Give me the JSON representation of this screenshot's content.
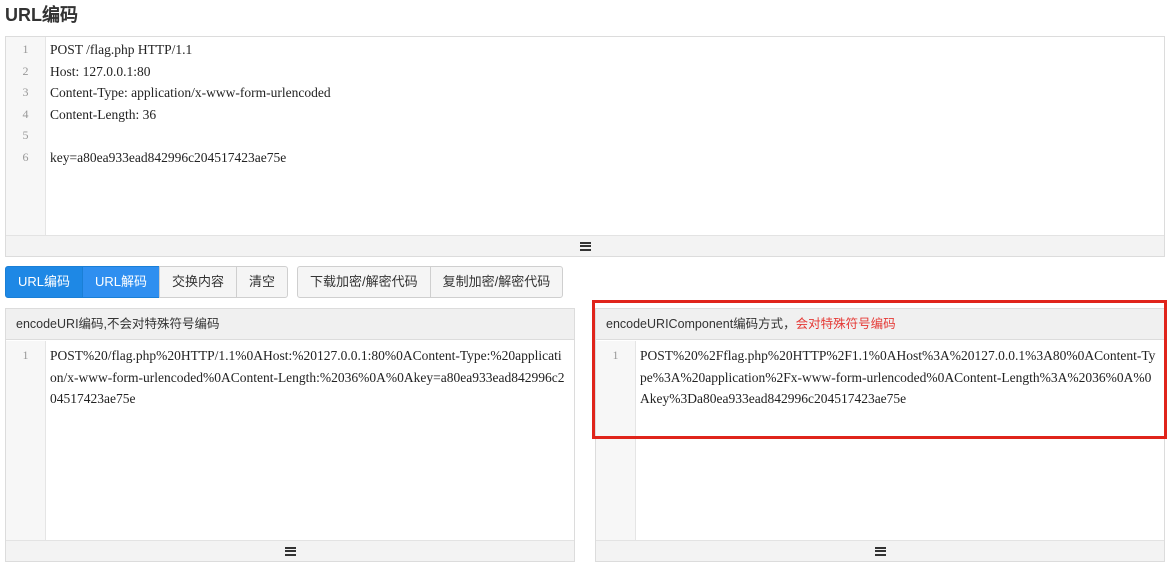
{
  "page": {
    "title": "URL编码"
  },
  "input_editor": {
    "line_numbers": [
      "1",
      "2",
      "3",
      "4",
      "5",
      "6"
    ],
    "lines": [
      "POST /flag.php HTTP/1.1",
      "Host: 127.0.0.1:80",
      "Content-Type: application/x-www-form-urlencoded",
      "Content-Length: 36",
      "",
      "key=a80ea933ead842996c204517423ae75e"
    ]
  },
  "toolbar": {
    "group1": [
      "URL编码",
      "URL解码",
      "交换内容",
      "清空"
    ],
    "group2": [
      "下载加密/解密代码",
      "复制加密/解密代码"
    ]
  },
  "panel_left": {
    "header": "encodeURI编码,不会对特殊符号编码",
    "line_number": "1",
    "output": "POST%20/flag.php%20HTTP/1.1%0AHost:%20127.0.0.1:80%0AContent-Type:%20application/x-www-form-urlencoded%0AContent-Length:%2036%0A%0Akey=a80ea933ead842996c204517423ae75e"
  },
  "panel_right": {
    "header_main": "encodeURIComponent编码方式，",
    "header_warn": "会对特殊符号编码",
    "line_number": "1",
    "output": "POST%20%2Fflag.php%20HTTP%2F1.1%0AHost%3A%20127.0.0.1%3A80%0AContent-Type%3A%20application%2Fx-www-form-urlencoded%0AContent-Length%3A%2036%0A%0Akey%3Da80ea933ead842996c204517423ae75e"
  },
  "colors": {
    "primary": "#1e88e5",
    "highlight_border": "#e0241b",
    "warn_text": "#e53935"
  }
}
